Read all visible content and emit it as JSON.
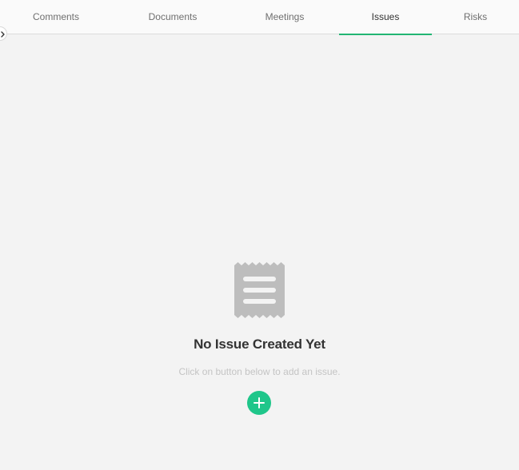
{
  "tabs": [
    {
      "label": "Comments"
    },
    {
      "label": "Documents"
    },
    {
      "label": "Meetings"
    },
    {
      "label": "Issues",
      "active": true
    },
    {
      "label": "Risks"
    }
  ],
  "empty_state": {
    "icon": "receipt-icon",
    "title": "No Issue Created Yet",
    "subtitle": "Click on button below to add an issue.",
    "add_button_icon": "plus-icon"
  },
  "colors": {
    "accent": "#22b573",
    "add_button": "#1fc68a",
    "background": "#f3f3f3",
    "icon_gray": "#bdbdbd"
  }
}
